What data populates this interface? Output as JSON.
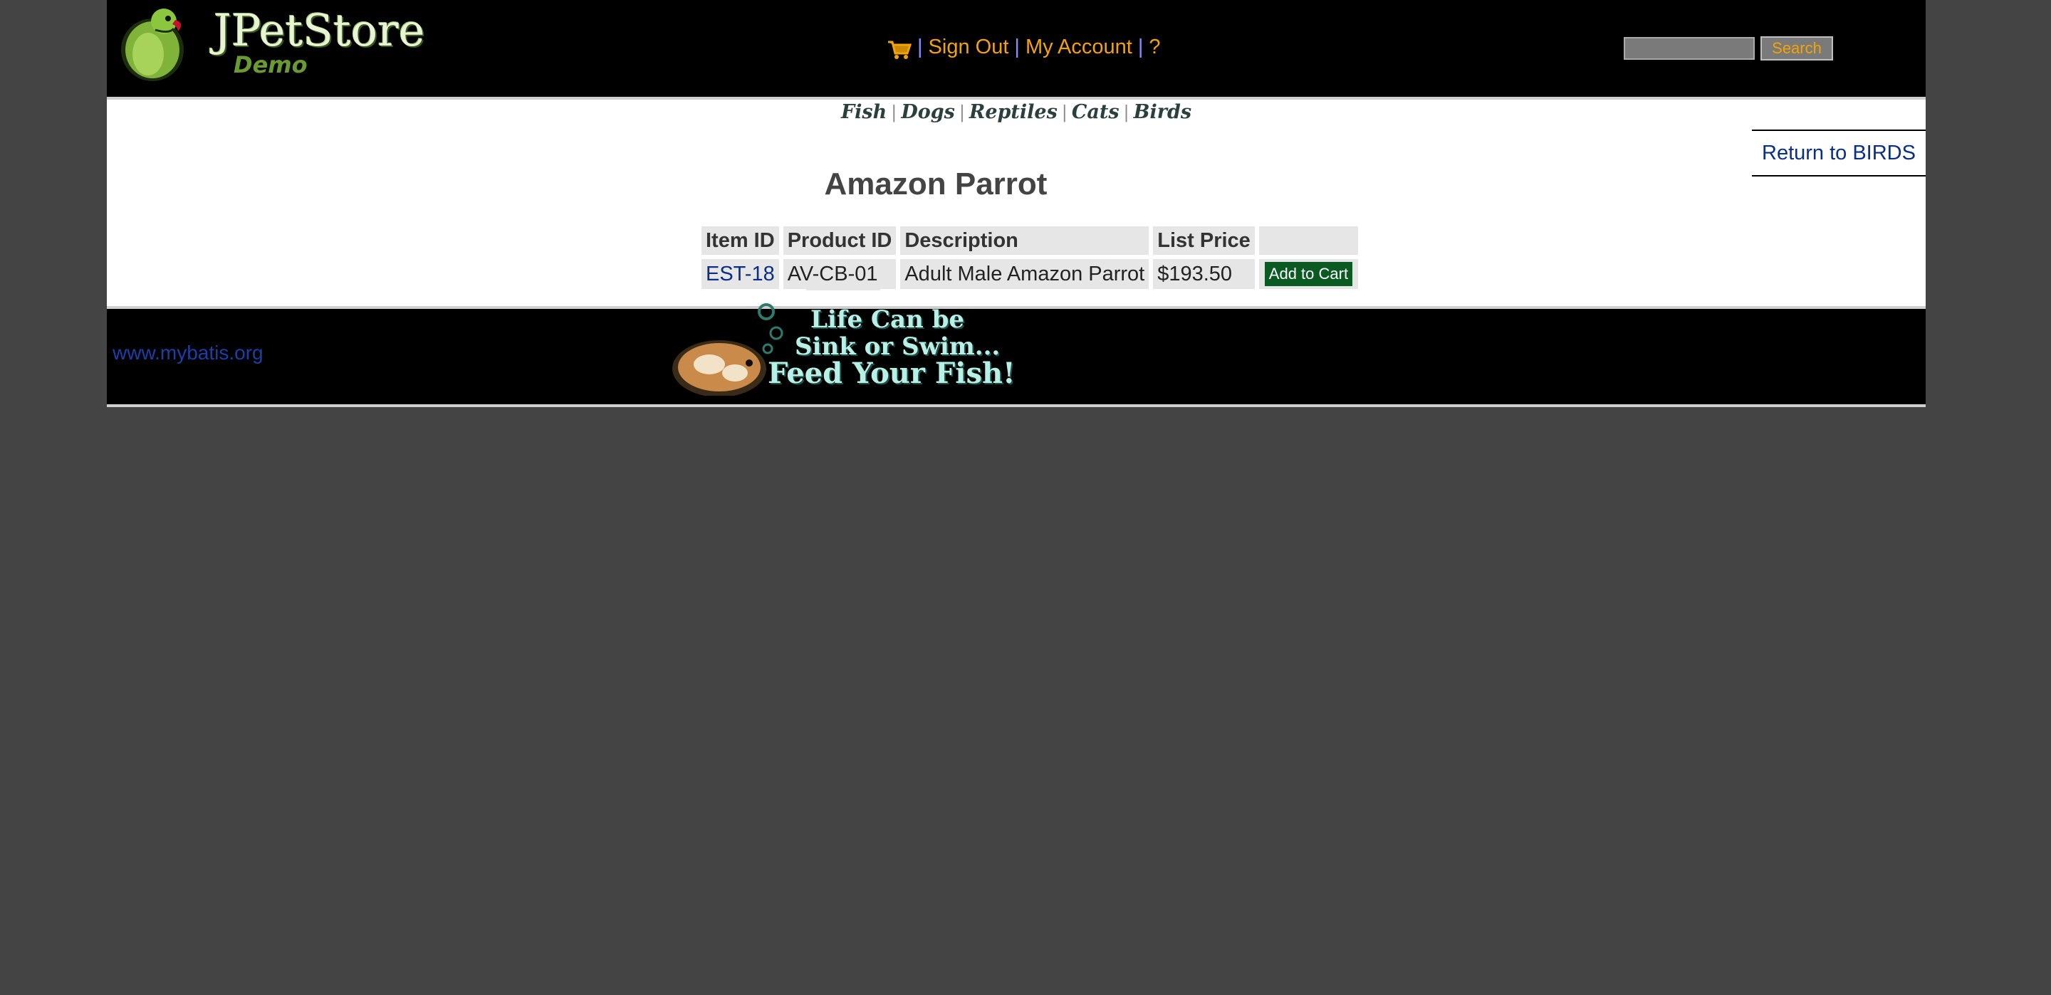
{
  "header": {
    "logo_title": "JPetStore",
    "logo_subtitle": "Demo",
    "menu": {
      "sign_out": "Sign Out",
      "my_account": "My Account",
      "help": "?",
      "separator": "|"
    },
    "search": {
      "input_value": "",
      "button_label": "Search"
    }
  },
  "quicklinks": [
    "Fish",
    "Dogs",
    "Reptiles",
    "Cats",
    "Birds"
  ],
  "return_link": "Return to BIRDS",
  "page_title": "Amazon Parrot",
  "table": {
    "headers": [
      "Item ID",
      "Product ID",
      "Description",
      "List Price",
      ""
    ],
    "rows": [
      {
        "item_id": "EST-18",
        "product_id": "AV-CB-01",
        "description": "Adult Male Amazon Parrot",
        "list_price": "$193.50",
        "action": "Add to Cart"
      }
    ]
  },
  "footer": {
    "link": "www.mybatis.org",
    "banner_lines": [
      "Life Can be",
      "Sink or Swim...",
      "Feed Your Fish!"
    ]
  },
  "colors": {
    "menu_text": "#f5a300",
    "link": "#0a2f86",
    "add_to_cart_bg": "#0a5a22",
    "page_background": "#444444"
  }
}
